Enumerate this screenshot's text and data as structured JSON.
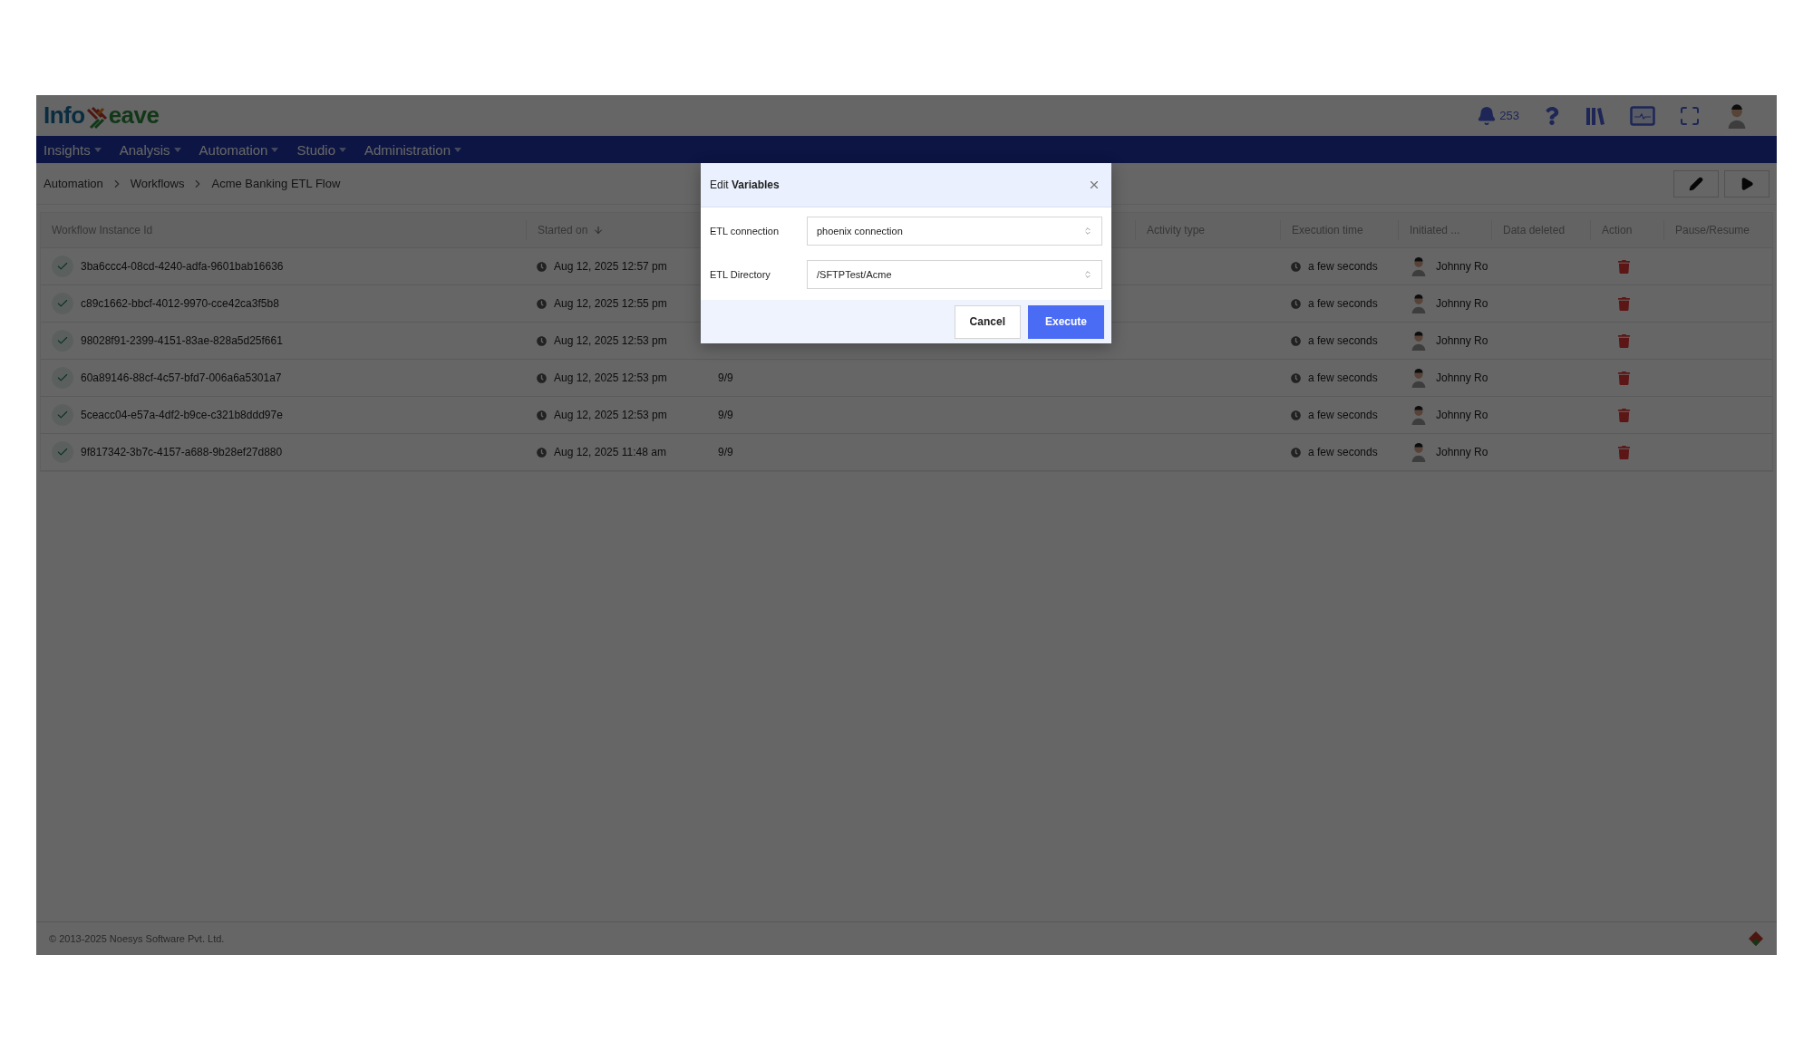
{
  "header": {
    "logo": {
      "part_1": "Info",
      "part_2": "eave"
    },
    "notifications": {
      "count": "253"
    }
  },
  "nav": [
    {
      "label": "Insights"
    },
    {
      "label": "Analysis"
    },
    {
      "label": "Automation"
    },
    {
      "label": "Studio"
    },
    {
      "label": "Administration"
    }
  ],
  "breadcrumb": [
    "Automation",
    "Workflows",
    "Acme Banking ETL Flow"
  ],
  "table": {
    "columns": [
      {
        "label": "Workflow Instance Id",
        "sorted": false
      },
      {
        "label": "Started on",
        "sorted": true
      },
      {
        "label": "Activity type",
        "sorted": false
      },
      {
        "label": "Execution time",
        "sorted": false
      },
      {
        "label": "Initiated ...",
        "sorted": false
      },
      {
        "label": "Data deleted",
        "sorted": false
      },
      {
        "label": "Action",
        "sorted": false
      },
      {
        "label": "Pause/Resume",
        "sorted": false
      }
    ],
    "rows": [
      {
        "succeeded": true,
        "id": "3ba6ccc4-08cd-4240-adfa-9601bab16636",
        "started_on": "Aug 12, 2025 12:57 pm",
        "execution_time": "a few seconds",
        "initiated_by": "Johnny Ro"
      },
      {
        "succeeded": true,
        "id": "c89c1662-bbcf-4012-9970-cce42ca3f5b8",
        "started_on": "Aug 12, 2025 12:55 pm",
        "execution_time": "a few seconds",
        "initiated_by": "Johnny Ro"
      },
      {
        "succeeded": true,
        "id": "98028f91-2399-4151-83ae-828a5d25f661",
        "started_on": "Aug 12, 2025 12:53 pm",
        "execution_time": "a few seconds",
        "initiated_by": "Johnny Ro"
      },
      {
        "succeeded": true,
        "id": "60a89146-88cf-4c57-bfd7-006a6a5301a7",
        "started_on": "Aug 12, 2025 12:53 pm",
        "column_3": "9/9",
        "execution_time": "a few seconds",
        "initiated_by": "Johnny Ro"
      },
      {
        "succeeded": true,
        "id": "5ceacc04-e57a-4df2-b9ce-c321b8ddd97e",
        "started_on": "Aug 12, 2025 12:53 pm",
        "column_3": "9/9",
        "execution_time": "a few seconds",
        "initiated_by": "Johnny Ro"
      },
      {
        "succeeded": true,
        "id": "9f817342-3b7c-4157-a688-9b28ef27d880",
        "started_on": "Aug 12, 2025 11:48 am",
        "column_3": "9/9",
        "execution_time": "a few seconds",
        "initiated_by": "Johnny Ro"
      }
    ]
  },
  "footer": {
    "copyright": "© 2013-2025 Noesys Software Pvt. Ltd."
  },
  "dialog": {
    "title": "Edit **Variables**",
    "fields": [
      {
        "label": "ETL connection",
        "value": "phoenix connection"
      },
      {
        "label": "ETL Directory",
        "value": "/SFTPTest/Acme"
      }
    ],
    "buttons": [
      {
        "label": "Cancel",
        "kind": "secondary"
      },
      {
        "label": "Execute",
        "kind": "primary"
      }
    ]
  }
}
